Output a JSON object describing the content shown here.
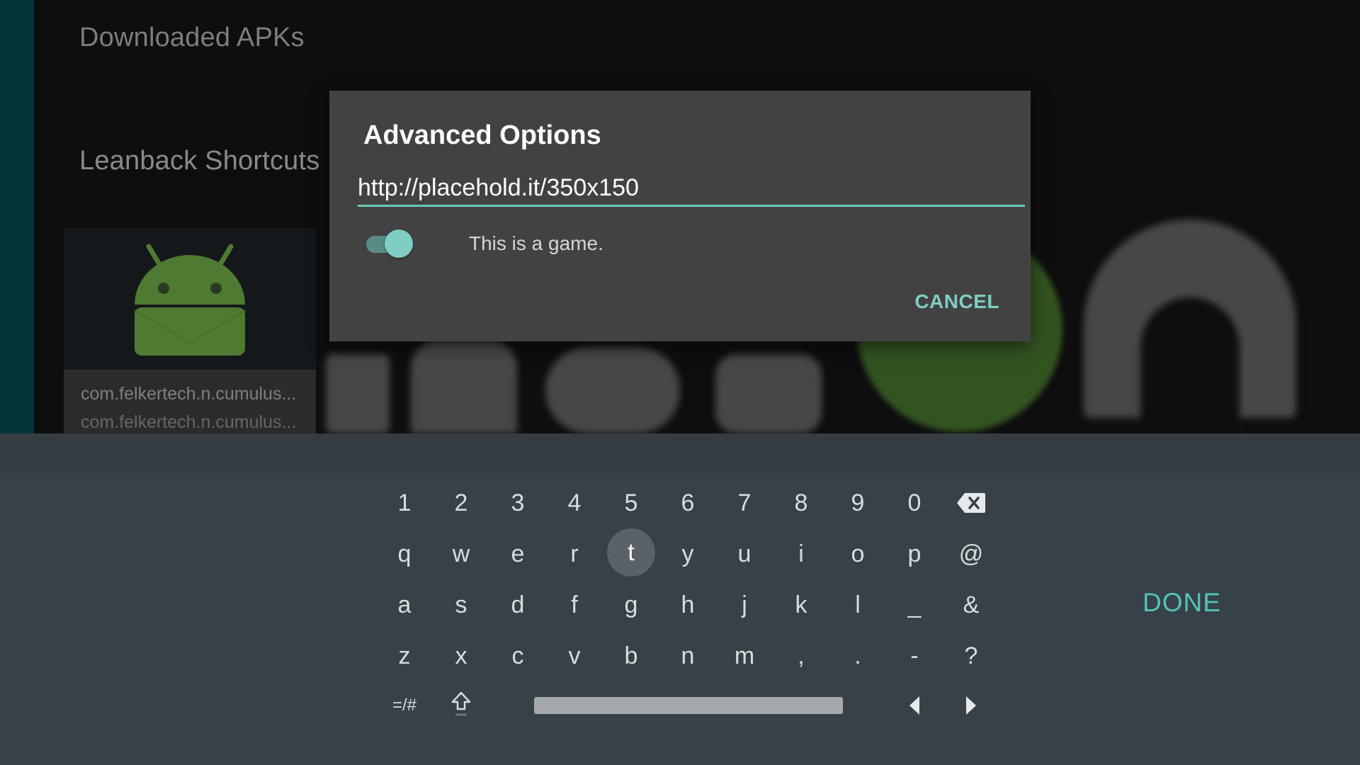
{
  "background": {
    "rows": {
      "downloaded_apks": "Downloaded APKs",
      "leanback_shortcuts": "Leanback Shortcuts"
    },
    "card": {
      "title": "com.felkertech.n.cumulus...",
      "subtitle": "com.felkertech.n.cumulus..."
    }
  },
  "dialog": {
    "title": "Advanced Options",
    "url_value": "http://placehold.it/350x150",
    "toggle_on": true,
    "toggle_label": "This is a game.",
    "cancel_label": "CANCEL"
  },
  "keyboard": {
    "rows": [
      [
        "1",
        "2",
        "3",
        "4",
        "5",
        "6",
        "7",
        "8",
        "9",
        "0"
      ],
      [
        "q",
        "w",
        "e",
        "r",
        "t",
        "y",
        "u",
        "i",
        "o",
        "p",
        "@"
      ],
      [
        "a",
        "s",
        "d",
        "f",
        "g",
        "h",
        "j",
        "k",
        "l",
        "_",
        "&"
      ],
      [
        "z",
        "x",
        "c",
        "v",
        "b",
        "n",
        "m",
        ",",
        ".",
        "-",
        "?"
      ]
    ],
    "focused_key": "t",
    "symbols_label": "=/#",
    "done_label": "DONE",
    "icons": {
      "backspace": "backspace-icon",
      "shift": "shift-icon",
      "left": "arrow-left-icon",
      "right": "arrow-right-icon"
    },
    "accent_color": "#54c3b7"
  }
}
